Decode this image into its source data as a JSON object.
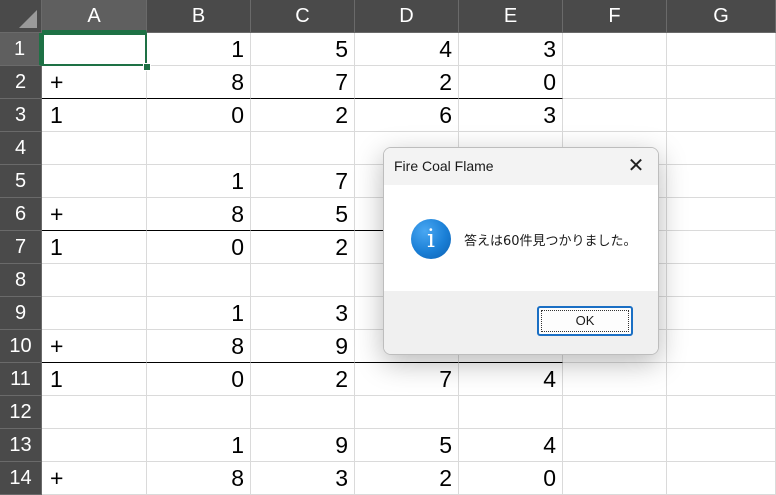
{
  "columns": [
    "A",
    "B",
    "C",
    "D",
    "E",
    "F",
    "G"
  ],
  "rows": [
    "1",
    "2",
    "3",
    "4",
    "5",
    "6",
    "7",
    "8",
    "9",
    "10",
    "11",
    "12",
    "13",
    "14"
  ],
  "selected_cell": "A1",
  "cells": {
    "r1": [
      "",
      "1",
      "5",
      "4",
      "3",
      "",
      ""
    ],
    "r2": [
      "+",
      "8",
      "7",
      "2",
      "0",
      "",
      ""
    ],
    "r3": [
      "1",
      "0",
      "2",
      "6",
      "3",
      "",
      ""
    ],
    "r4": [
      "",
      "",
      "",
      "",
      "",
      "",
      ""
    ],
    "r5": [
      "",
      "1",
      "7",
      "",
      "",
      "",
      ""
    ],
    "r6": [
      "+",
      "8",
      "5",
      "",
      "",
      "",
      ""
    ],
    "r7": [
      "1",
      "0",
      "2",
      "",
      "",
      "",
      ""
    ],
    "r8": [
      "",
      "",
      "",
      "",
      "",
      "",
      ""
    ],
    "r9": [
      "",
      "1",
      "3",
      "",
      "",
      "",
      ""
    ],
    "r10": [
      "+",
      "8",
      "9",
      "",
      "",
      "",
      ""
    ],
    "r11": [
      "1",
      "0",
      "2",
      "7",
      "4",
      "",
      ""
    ],
    "r12": [
      "",
      "",
      "",
      "",
      "",
      "",
      ""
    ],
    "r13": [
      "",
      "1",
      "9",
      "5",
      "4",
      "",
      ""
    ],
    "r14": [
      "+",
      "8",
      "3",
      "2",
      "0",
      "",
      ""
    ]
  },
  "dialog": {
    "title": "Fire Coal Flame",
    "close_glyph": "✕",
    "icon": "info-icon",
    "icon_glyph": "i",
    "message": "答えは60件見つかりました。",
    "ok_label": "OK"
  },
  "colors": {
    "header_bg": "#4a4a4a",
    "selection": "#1e7145",
    "info_icon": "#1a7fd6",
    "button_border": "#1a6fc4"
  }
}
